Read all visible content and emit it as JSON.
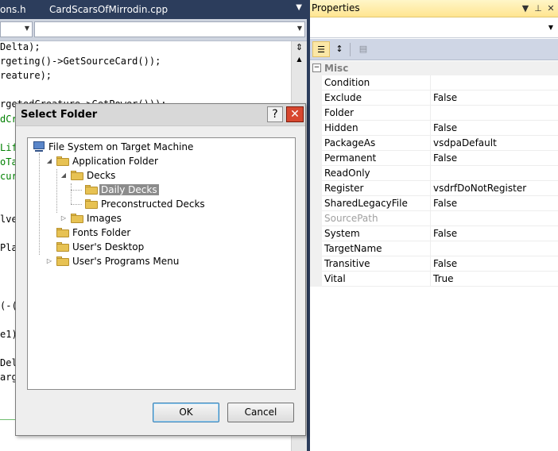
{
  "editor": {
    "tabs": [
      "ons.h",
      "CardScarsOfMirrodin.cpp"
    ],
    "code_lines": [
      {
        "text": "Delta);",
        "green": false
      },
      {
        "text": "rgeting()->GetSourceCard());",
        "green": false
      },
      {
        "text": "reature);",
        "green": false
      },
      {
        "text": "",
        "green": false
      },
      {
        "text": "rgetedCreature->GetPower()));",
        "green": false
      },
      {
        "text": "dCr",
        "green": true
      },
      {
        "text": "",
        "green": false
      },
      {
        "text": "Lif",
        "green": true
      },
      {
        "text": "oTa",
        "green": true
      },
      {
        "text": "cur",
        "green": true
      },
      {
        "text": "",
        "green": false
      },
      {
        "text": "",
        "green": false
      },
      {
        "text": "lve",
        "green": false
      },
      {
        "text": "",
        "green": false
      },
      {
        "text": "Play",
        "green": false
      },
      {
        "text": "",
        "green": false
      },
      {
        "text": "",
        "green": false
      },
      {
        "text": "",
        "green": false
      },
      {
        "text": "(-(",
        "green": false
      },
      {
        "text": "",
        "green": false
      },
      {
        "text": "e1)",
        "green": false
      },
      {
        "text": "",
        "green": false
      },
      {
        "text": "Del",
        "green": false
      },
      {
        "text": "arge",
        "green": false
      }
    ]
  },
  "properties": {
    "title": "Properties",
    "category": "Misc",
    "rows": [
      {
        "name": "Condition",
        "value": "",
        "disabled": false
      },
      {
        "name": "Exclude",
        "value": "False",
        "disabled": false
      },
      {
        "name": "Folder",
        "value": "",
        "disabled": false
      },
      {
        "name": "Hidden",
        "value": "False",
        "disabled": false
      },
      {
        "name": "PackageAs",
        "value": "vsdpaDefault",
        "disabled": false
      },
      {
        "name": "Permanent",
        "value": "False",
        "disabled": false
      },
      {
        "name": "ReadOnly",
        "value": "",
        "disabled": false
      },
      {
        "name": "Register",
        "value": "vsdrfDoNotRegister",
        "disabled": false
      },
      {
        "name": "SharedLegacyFile",
        "value": "False",
        "disabled": false
      },
      {
        "name": "SourcePath",
        "value": "",
        "disabled": true
      },
      {
        "name": "System",
        "value": "False",
        "disabled": false
      },
      {
        "name": "TargetName",
        "value": "",
        "disabled": false
      },
      {
        "name": "Transitive",
        "value": "False",
        "disabled": false
      },
      {
        "name": "Vital",
        "value": "True",
        "disabled": false
      }
    ]
  },
  "dialog": {
    "title": "Select Folder",
    "tree": [
      {
        "label": "File System on Target Machine",
        "icon": "computer-icon",
        "level": 0,
        "toggle": "",
        "selected": false
      },
      {
        "label": "Application Folder",
        "icon": "folder-icon",
        "level": 1,
        "toggle": "expanded",
        "selected": false
      },
      {
        "label": "Decks",
        "icon": "folder-icon",
        "level": 2,
        "toggle": "expanded",
        "selected": false
      },
      {
        "label": "Daily Decks",
        "icon": "folder-open-icon",
        "level": 3,
        "toggle": "",
        "selected": true
      },
      {
        "label": "Preconstructed Decks",
        "icon": "folder-icon",
        "level": 3,
        "toggle": "",
        "selected": false
      },
      {
        "label": "Images",
        "icon": "folder-icon",
        "level": 2,
        "toggle": "collapsed",
        "selected": false
      },
      {
        "label": "Fonts Folder",
        "icon": "folder-icon",
        "level": 1,
        "toggle": "",
        "selected": false
      },
      {
        "label": "User's Desktop",
        "icon": "folder-icon",
        "level": 1,
        "toggle": "",
        "selected": false
      },
      {
        "label": "User's Programs Menu",
        "icon": "folder-icon",
        "level": 1,
        "toggle": "collapsed",
        "selected": false
      }
    ],
    "ok_label": "OK",
    "cancel_label": "Cancel"
  }
}
